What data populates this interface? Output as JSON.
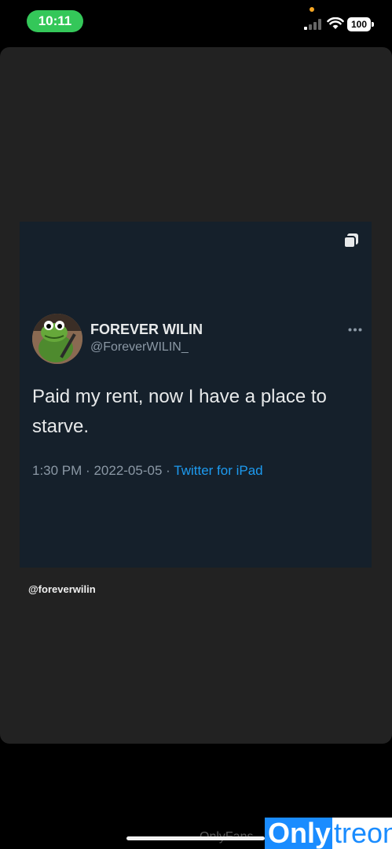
{
  "status_bar": {
    "time": "10:11",
    "battery": "100",
    "colors": {
      "time_pill": "#34c759",
      "privacy_dot": "#f5a623"
    },
    "icons": [
      "signal-icon",
      "wifi-icon",
      "battery-icon"
    ]
  },
  "tweet": {
    "display_name": "FOREVER WILIN",
    "handle": "@ForeverWILIN_",
    "text": "Paid my rent, now I have a place to starve.",
    "time": "1:30 PM",
    "separator": "·",
    "date": "2022-05-05",
    "source": "Twitter for iPad",
    "icons": [
      "multiple-images-icon",
      "more-icon"
    ],
    "colors": {
      "card_bg": "#15202b",
      "link": "#1d9bf0",
      "muted": "#8b98a5"
    }
  },
  "post": {
    "credit": "@foreverwilin"
  },
  "watermarks": {
    "onlyfans": "OnlyFans",
    "onlytreon_prefix": "Only",
    "onlytreon_suffix": "treon"
  }
}
